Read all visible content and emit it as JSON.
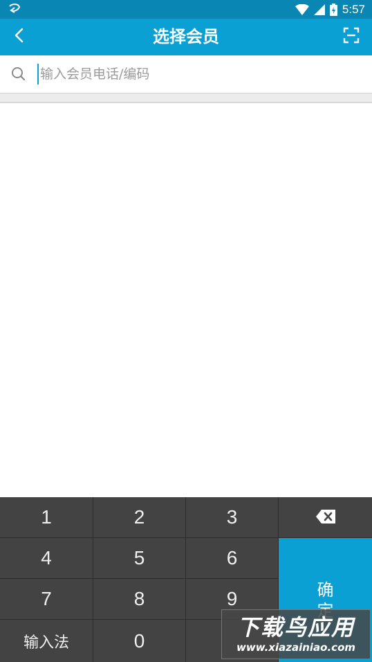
{
  "status_bar": {
    "time": "5:57",
    "app_icon": "notification-app-icon",
    "icons": [
      "wifi-icon",
      "signal-icon",
      "battery-charging-icon"
    ]
  },
  "app_bar": {
    "title": "选择会员",
    "back_icon": "back-arrow-icon",
    "scan_icon": "scan-icon",
    "background": "#0aa0d4"
  },
  "search": {
    "placeholder": "输入会员电话/编码",
    "value": "",
    "icon": "search-icon"
  },
  "keypad": {
    "keys": [
      "1",
      "2",
      "3",
      "4",
      "5",
      "6",
      "7",
      "8",
      "9",
      "0"
    ],
    "ime_label": "输入法",
    "delete_icon": "backspace-icon",
    "confirm_label_line1": "确",
    "confirm_label_line2": "定",
    "confirm_color": "#0aa0d4"
  },
  "watermark": {
    "line1": "下载鸟应用",
    "line2": "www.xiazainiao.com"
  }
}
